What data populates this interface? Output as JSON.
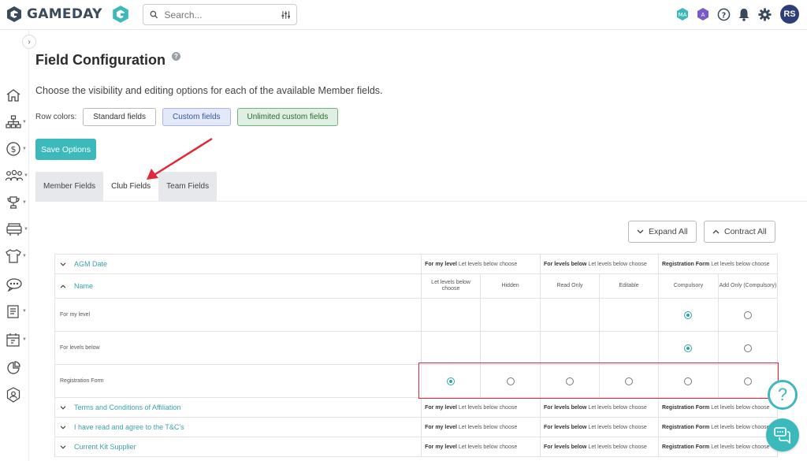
{
  "header": {
    "brand": "GAMEDAY",
    "search_placeholder": "Search...",
    "avatar_initials": "RS"
  },
  "page": {
    "title": "Field Configuration",
    "description": "Choose the visibility and editing options for each of the available Member fields.",
    "row_colors_label": "Row colors:",
    "row_colors": [
      "Standard fields",
      "Custom fields",
      "Unlimited custom fields"
    ],
    "save_label": "Save Options"
  },
  "tabs": [
    {
      "label": "Member Fields",
      "active": false
    },
    {
      "label": "Club Fields",
      "active": true
    },
    {
      "label": "Team Fields",
      "active": false
    }
  ],
  "controls": {
    "expand_all": "Expand All",
    "contract_all": "Contract All"
  },
  "table": {
    "summary_headers": {
      "my_level_bold": "For my level",
      "my_level_rest": " Let levels below choose",
      "below_bold": "For levels below",
      "below_rest": " Let levels below choose",
      "reg_bold": "Registration Form",
      "reg_rest": " Let levels below choose"
    },
    "fields": [
      "AGM Date",
      "Name",
      "Terms and Conditions of Affiliation",
      "I have read and agree to the T&C's",
      "Current Kit Supplier"
    ],
    "option_headers": [
      "Let levels below choose",
      "Hidden",
      "Read Only",
      "Editable",
      "Compulsory",
      "Add Only (Compulsory)"
    ],
    "rows": [
      {
        "label": "For my level",
        "radios": [
          false,
          false,
          false,
          false,
          true,
          false
        ],
        "shown": [
          false,
          false,
          false,
          false,
          true,
          true
        ]
      },
      {
        "label": "For levels below",
        "radios": [
          false,
          false,
          false,
          false,
          true,
          false
        ],
        "shown": [
          false,
          false,
          false,
          false,
          true,
          true
        ]
      },
      {
        "label": "Registration Form",
        "radios": [
          true,
          false,
          false,
          false,
          false,
          false
        ],
        "shown": [
          true,
          true,
          true,
          true,
          true,
          true
        ]
      }
    ]
  },
  "colors": {
    "accent": "#3cb9ba",
    "highlight": "#e0283a"
  }
}
